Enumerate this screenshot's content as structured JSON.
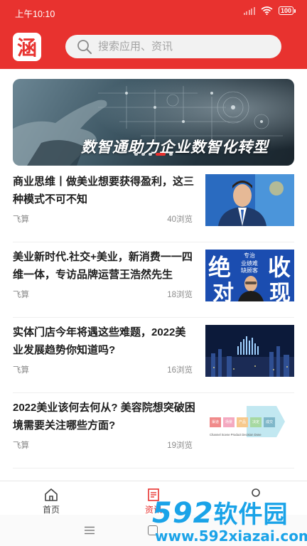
{
  "status_bar": {
    "time": "上午10:10",
    "battery": "100"
  },
  "header": {
    "logo_char": "涵",
    "search_placeholder": "搜索应用、资讯"
  },
  "banner": {
    "title": "数智通助力企业数智化转型",
    "slide_count": 5,
    "active_slide": 3
  },
  "articles": [
    {
      "title": "商业思维丨做美业想要获得盈利，这三种模式不可不知",
      "author": "飞算",
      "views": "40浏览"
    },
    {
      "title": "美业新时代.社交+美业，新消费一一四维一体，专访品牌运营王浩然先生",
      "author": "飞算",
      "views": "18浏览",
      "thumb_text": {
        "big_left": "绝",
        "big_left2": "对",
        "big_right": "收",
        "big_right2": "现",
        "line1": "专治",
        "line2": "业绩难",
        "line3": "缺顾客"
      }
    },
    {
      "title": "实体门店今年将遇这些难题，2022美业发展趋势你知道吗?",
      "author": "飞算",
      "views": "16浏览"
    },
    {
      "title": "2022美业该何去何从? 美容院想突破困境需要关注哪些方面?",
      "author": "飞算",
      "views": "19浏览",
      "thumb_steps": [
        "渠道",
        "场景",
        "产品",
        "决定",
        "成交"
      ],
      "thumb_caption": "Channel Scene Product Decision Done"
    }
  ],
  "tab_bar": {
    "tabs": [
      {
        "label": "首页"
      },
      {
        "label": "资讯"
      },
      {
        "label": ""
      }
    ],
    "active": 1
  },
  "watermark": {
    "big": "592",
    "cn": "软件园",
    "url": "www.592xiazai.com"
  },
  "colors": {
    "brand_red": "#e8322f",
    "watermark_blue": "#1aa3e8"
  }
}
